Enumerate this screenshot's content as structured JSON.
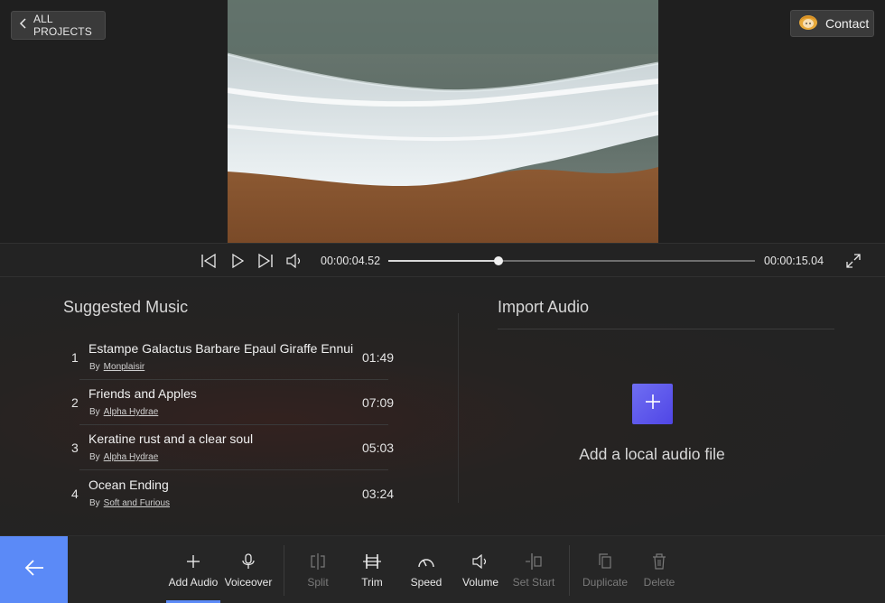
{
  "header": {
    "back_label": "ALL PROJECTS",
    "contact_label": "Contact"
  },
  "player": {
    "current_time": "00:00:04.52",
    "total_time": "00:00:15.04",
    "progress": 0.3
  },
  "suggested": {
    "title": "Suggested Music",
    "by_label": "By",
    "songs": [
      {
        "num": "1",
        "title": "Estampe Galactus Barbare Epaul Giraffe Ennui",
        "artist": "Monplaisir",
        "duration": "01:49"
      },
      {
        "num": "2",
        "title": "Friends and Apples",
        "artist": "Alpha Hydrae",
        "duration": "07:09"
      },
      {
        "num": "3",
        "title": "Keratine rust and a clear soul",
        "artist": "Alpha Hydrae",
        "duration": "05:03"
      },
      {
        "num": "4",
        "title": "Ocean Ending",
        "artist": "Soft and Furious",
        "duration": "03:24"
      }
    ]
  },
  "import": {
    "title": "Import Audio",
    "add_label": "Add a local audio file"
  },
  "toolbar": {
    "add_audio": "Add Audio",
    "voiceover": "Voiceover",
    "split": "Split",
    "trim": "Trim",
    "speed": "Speed",
    "volume": "Volume",
    "set_start": "Set Start",
    "duplicate": "Duplicate",
    "delete": "Delete"
  },
  "colors": {
    "accent": "#5b8af7",
    "add_button": "#5d55ec"
  }
}
